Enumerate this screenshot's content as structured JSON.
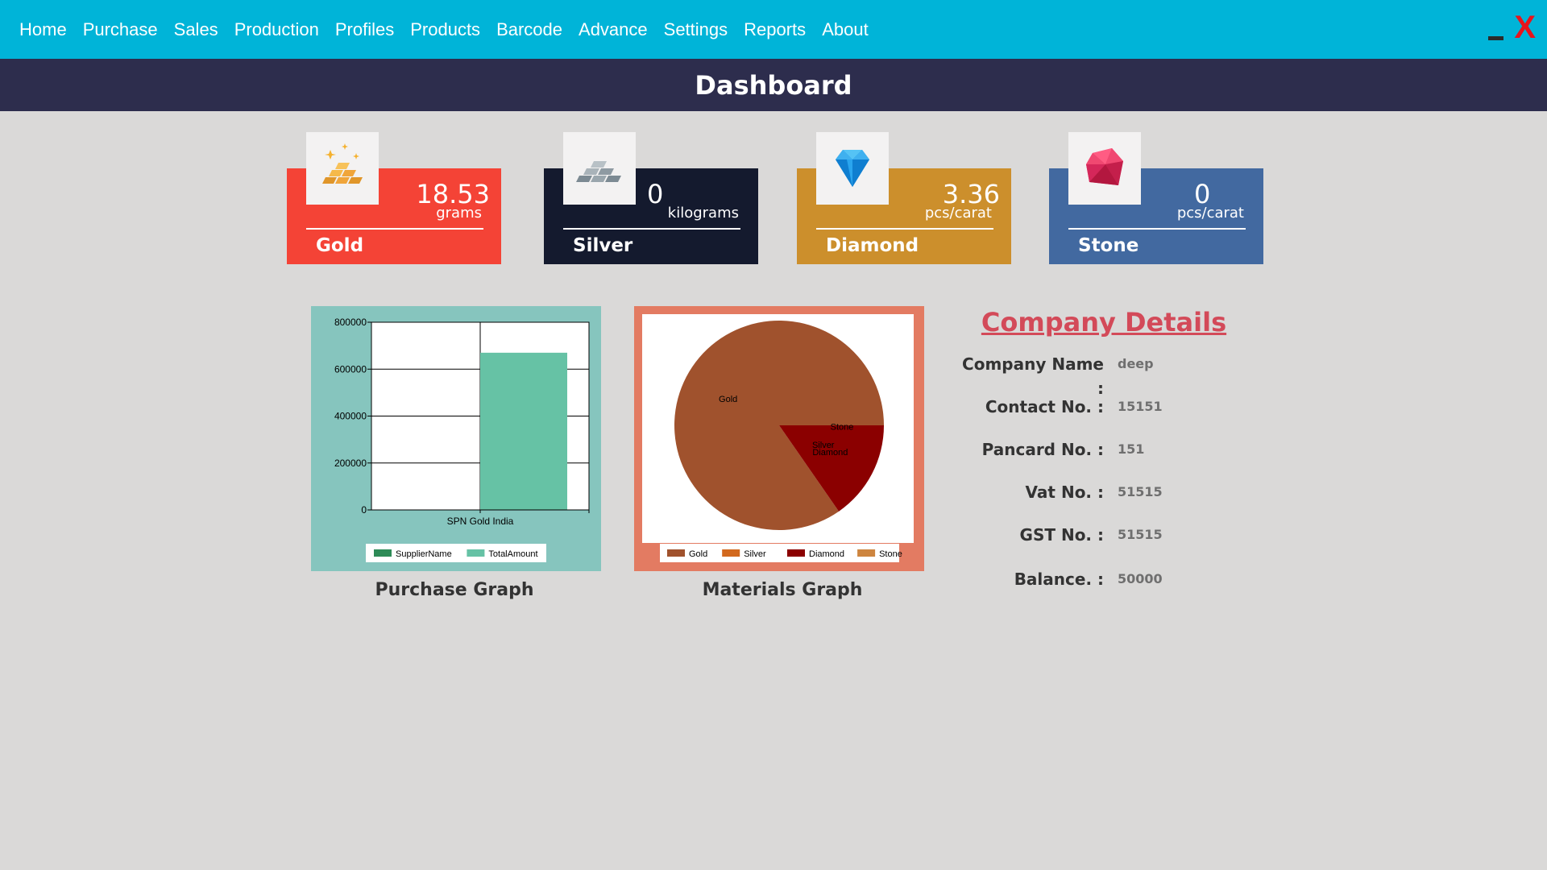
{
  "menu": {
    "items": [
      "Home",
      "Purchase",
      "Sales",
      "Production",
      "Profiles",
      "Products",
      "Barcode",
      "Advance",
      "Settings",
      "Reports",
      "About"
    ],
    "minimize_label": "",
    "close_label": "X"
  },
  "header": {
    "title": "Dashboard"
  },
  "cards": [
    {
      "label": "Gold",
      "value": "18.53",
      "unit": "grams",
      "color": "#f44336",
      "icon": "gold-bars-icon"
    },
    {
      "label": "Silver",
      "value": "0",
      "unit": "kilograms",
      "color": "#141a2e",
      "icon": "silver-bars-icon"
    },
    {
      "label": "Diamond",
      "value": "3.36",
      "unit": "pcs/carat",
      "color": "#cc8f2c",
      "icon": "diamond-icon"
    },
    {
      "label": "Stone",
      "value": "0",
      "unit": "pcs/carat",
      "color": "#4269a0",
      "icon": "gemstone-icon"
    }
  ],
  "graphs": {
    "purchase": {
      "caption": "Purchase Graph",
      "frame_color": "#86c5be"
    },
    "materials": {
      "caption": "Materials Graph",
      "frame_color": "#e37b62"
    }
  },
  "chart_data": [
    {
      "type": "bar",
      "categories": [
        "SPN Gold India"
      ],
      "series": [
        {
          "name": "SupplierName",
          "values": [
            0
          ],
          "color": "#2e8b57"
        },
        {
          "name": "TotalAmount",
          "values": [
            670000
          ],
          "color": "#66c2a5"
        }
      ],
      "ylim": [
        0,
        800000
      ],
      "yticks": [
        "0",
        "200000",
        "400000",
        "600000",
        "800000"
      ],
      "grid": true,
      "legend": "bottom"
    },
    {
      "type": "pie",
      "labels": [
        "Gold",
        "Silver",
        "Diamond",
        "Stone"
      ],
      "values": [
        84.65,
        0,
        15.35,
        0
      ],
      "colors": [
        "#a0522d",
        "#d2691e",
        "#8b0000",
        "#cd853f"
      ],
      "legend": "bottom"
    }
  ],
  "company": {
    "title": "Company Details",
    "fields": [
      {
        "label": "Company Name :",
        "value": "deep"
      },
      {
        "label": "Contact No. :",
        "value": "15151"
      },
      {
        "label": "Pancard No. :",
        "value": "151"
      },
      {
        "label": "Vat No. :",
        "value": "51515"
      },
      {
        "label": "GST No. :",
        "value": "51515"
      },
      {
        "label": "Balance. :",
        "value": "50000"
      }
    ]
  }
}
